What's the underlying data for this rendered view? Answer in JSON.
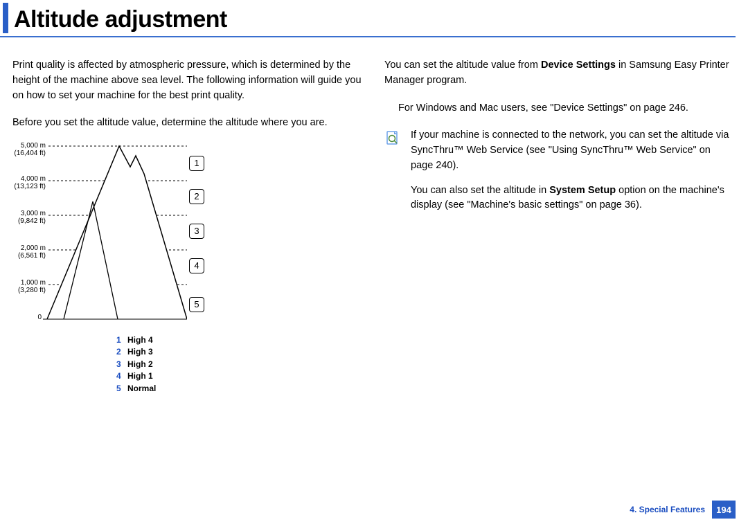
{
  "title": "Altitude adjustment",
  "leftCol": {
    "p1": "Print quality is affected by atmospheric pressure, which is determined by the height of the machine above sea level. The following information will guide you on how to set your machine for the best print quality.",
    "p2": "Before you set the altitude value, determine the altitude where you are."
  },
  "altLabels": [
    {
      "m": "5,000 m",
      "ft": "(16,404 ft)"
    },
    {
      "m": "4,000 m",
      "ft": "(13,123 ft)"
    },
    {
      "m": "3,000 m",
      "ft": "(9,842 ft)"
    },
    {
      "m": "2,000 m",
      "ft": "(6,561 ft)"
    },
    {
      "m": "1,000 m",
      "ft": "(3,280 ft)"
    },
    {
      "m": "0",
      "ft": ""
    }
  ],
  "callouts": [
    "1",
    "2",
    "3",
    "4",
    "5"
  ],
  "legend": [
    {
      "n": "1",
      "l": "High 4"
    },
    {
      "n": "2",
      "l": "High 3"
    },
    {
      "n": "3",
      "l": "High 2"
    },
    {
      "n": "4",
      "l": "High 1"
    },
    {
      "n": "5",
      "l": "Normal"
    }
  ],
  "rightCol": {
    "p1a": "You can set the altitude value from ",
    "p1b": "Device Settings",
    "p1c": " in Samsung Easy Printer Manager program.",
    "p2": "For Windows and Mac users, see \"Device Settings\" on page 246.",
    "note1": "If your machine is connected to the network, you can set the altitude via SyncThru™ Web Service (see \"Using SyncThru™ Web Service\" on page 240).",
    "note2a": "You can also set the altitude in ",
    "note2b": "System Setup",
    "note2c": " option on the machine's display (see \"Machine's basic settings\" on page 36)."
  },
  "footer": {
    "chapter": "4.  Special Features",
    "page": "194"
  }
}
